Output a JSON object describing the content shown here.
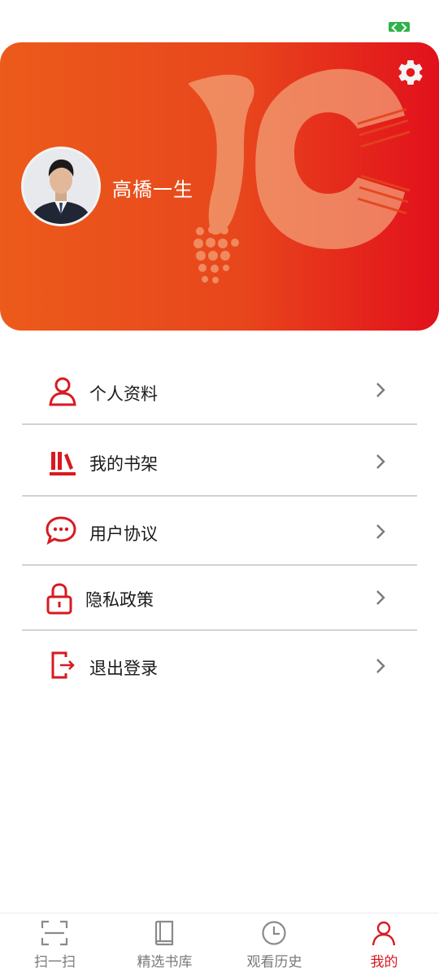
{
  "status_bar": {
    "battery": "charging"
  },
  "profile": {
    "name": "高橋一生",
    "avatar": "user-avatar",
    "settings": "gear-icon",
    "colors": {
      "gradient_start": "#ec5b1b",
      "gradient_end": "#e2101c"
    }
  },
  "menu": {
    "items": [
      {
        "label": "个人资料",
        "icon": "user-icon"
      },
      {
        "label": "我的书架",
        "icon": "bookshelf-icon"
      },
      {
        "label": "用户协议",
        "icon": "chat-bubble-icon"
      },
      {
        "label": "隐私政策",
        "icon": "lock-icon"
      },
      {
        "label": "退出登录",
        "icon": "logout-icon"
      }
    ]
  },
  "tab_bar": {
    "active_index": 3,
    "active_color": "#d71a21",
    "tabs": [
      {
        "label": "扫一扫",
        "icon": "scan-icon"
      },
      {
        "label": "精选书库",
        "icon": "book-icon"
      },
      {
        "label": "观看历史",
        "icon": "clock-icon"
      },
      {
        "label": "我的",
        "icon": "person-icon"
      }
    ]
  }
}
